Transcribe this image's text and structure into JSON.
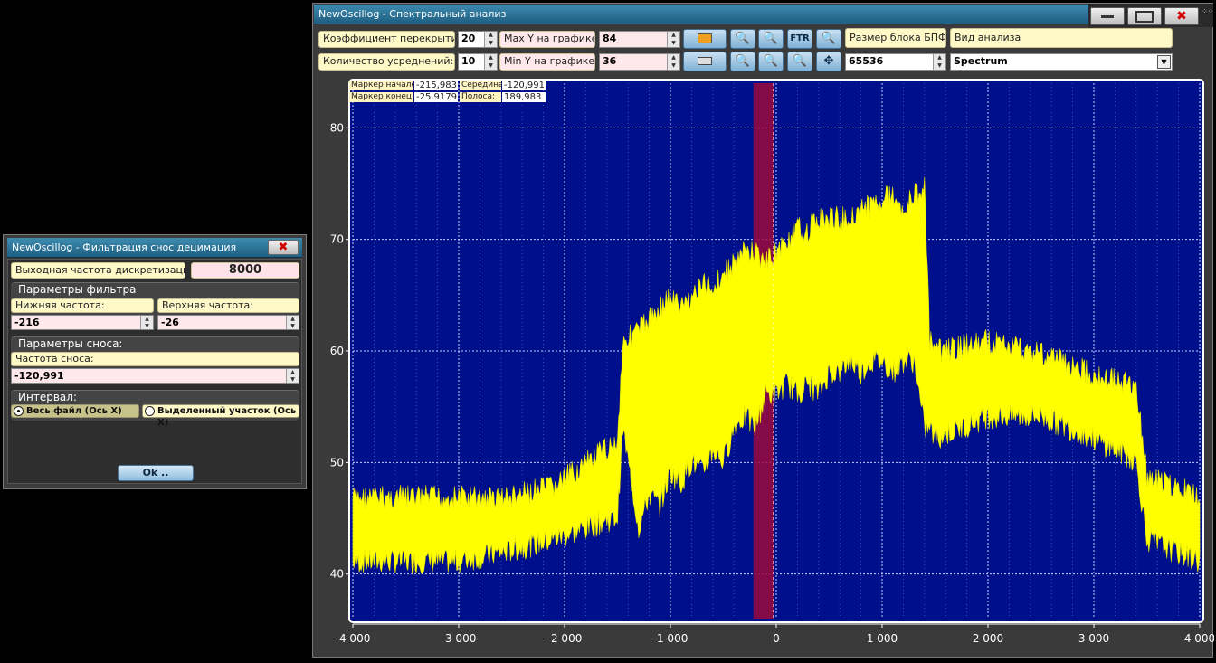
{
  "filter_window": {
    "title": "NewOscillog - Фильтрация снос децимация",
    "output_rate_label": "Выходная частота дискретизации:",
    "output_rate_value": "8000",
    "filter_group_label": "Параметры фильтра",
    "low_freq_label": "Нижняя частота:",
    "high_freq_label": "Верхняя частота:",
    "low_freq_value": "-216",
    "high_freq_value": "-26",
    "shift_group_label": "Параметры сноса:",
    "shift_freq_label": "Частота сноса:",
    "shift_freq_value": "-120,991",
    "interval_label": "Интервал:",
    "interval_options": [
      "Весь файл (Ось Х)",
      "Выделенный участок (Ось Х)"
    ],
    "interval_selected": 0,
    "ok_label": "Ok .."
  },
  "spectrum_window": {
    "title": "NewOscillog - Спектральный анализ",
    "close_glyph": "✖",
    "overlap_label": "Коэффициент перекрытия:",
    "overlap_value": "20",
    "avg_label": "Количество усреднений:",
    "avg_value": "10",
    "maxy_label": "Max Y на графике:",
    "maxy_value": "84",
    "miny_label": "Min Y на графике:",
    "miny_value": "36",
    "ftr_label": "FTR",
    "fft_size_label": "Размер блока БПФ",
    "fft_size_value": "65536",
    "analysis_label": "Вид анализа",
    "analysis_value": "Spectrum",
    "markers": {
      "start_label": "Маркер начало:",
      "start_value": "-215,983",
      "mid_label": "Середина:",
      "mid_value": "-120,991",
      "end_label": "Маркер конец:",
      "end_value": "-25,9179",
      "band_label": "Полоса:",
      "band_value": "189,983"
    }
  },
  "colors": {
    "plot_bg": "#000f8c",
    "signal": "#ffff00",
    "selection": "#9b0a3c",
    "title_bar": "#2a6f94"
  },
  "chart_data": {
    "type": "area",
    "xlim": [
      -4000,
      4000
    ],
    "ylim": [
      36,
      84
    ],
    "x_ticks": [
      -4000,
      -3000,
      -2000,
      -1000,
      0,
      1000,
      2000,
      3000,
      4000
    ],
    "x_tick_labels": [
      "-4 000",
      "-3 000",
      "-2 000",
      "-1 000",
      "0",
      "1 000",
      "2 000",
      "3 000",
      "4 000"
    ],
    "y_ticks": [
      40,
      50,
      60,
      70,
      80
    ],
    "y_tick_labels": [
      "40",
      "50",
      "60",
      "70",
      "80"
    ],
    "grid": true,
    "selection_range": [
      -215.983,
      -25.9179
    ],
    "x": [
      -4000,
      -3500,
      -3000,
      -2500,
      -2100,
      -1500,
      -1450,
      -1300,
      -1200,
      -1100,
      -1000,
      -900,
      -800,
      -700,
      -600,
      -500,
      -400,
      -300,
      -200,
      -100,
      0,
      100,
      200,
      300,
      400,
      500,
      600,
      700,
      800,
      900,
      1000,
      1100,
      1200,
      1300,
      1400,
      1450,
      1500,
      2000,
      2500,
      3000,
      3400,
      3500,
      4000
    ],
    "upper": [
      48,
      48,
      48,
      48,
      49,
      53,
      62,
      63,
      64,
      65,
      66,
      65,
      66,
      67,
      67,
      68,
      69,
      70,
      70,
      69,
      70,
      71,
      72,
      72,
      73,
      73,
      73,
      73,
      74,
      74,
      75,
      75,
      74,
      75,
      76,
      62,
      61,
      62,
      61,
      59,
      58,
      50,
      48
    ],
    "lower": [
      40,
      40,
      40,
      41,
      42,
      44,
      52,
      43,
      46,
      45,
      48,
      47,
      49,
      48,
      50,
      49,
      52,
      53,
      52,
      55,
      55,
      56,
      55,
      56,
      55,
      57,
      57,
      58,
      57,
      58,
      58,
      57,
      58,
      58,
      52,
      52,
      51,
      53,
      53,
      51,
      49,
      42,
      40
    ]
  }
}
